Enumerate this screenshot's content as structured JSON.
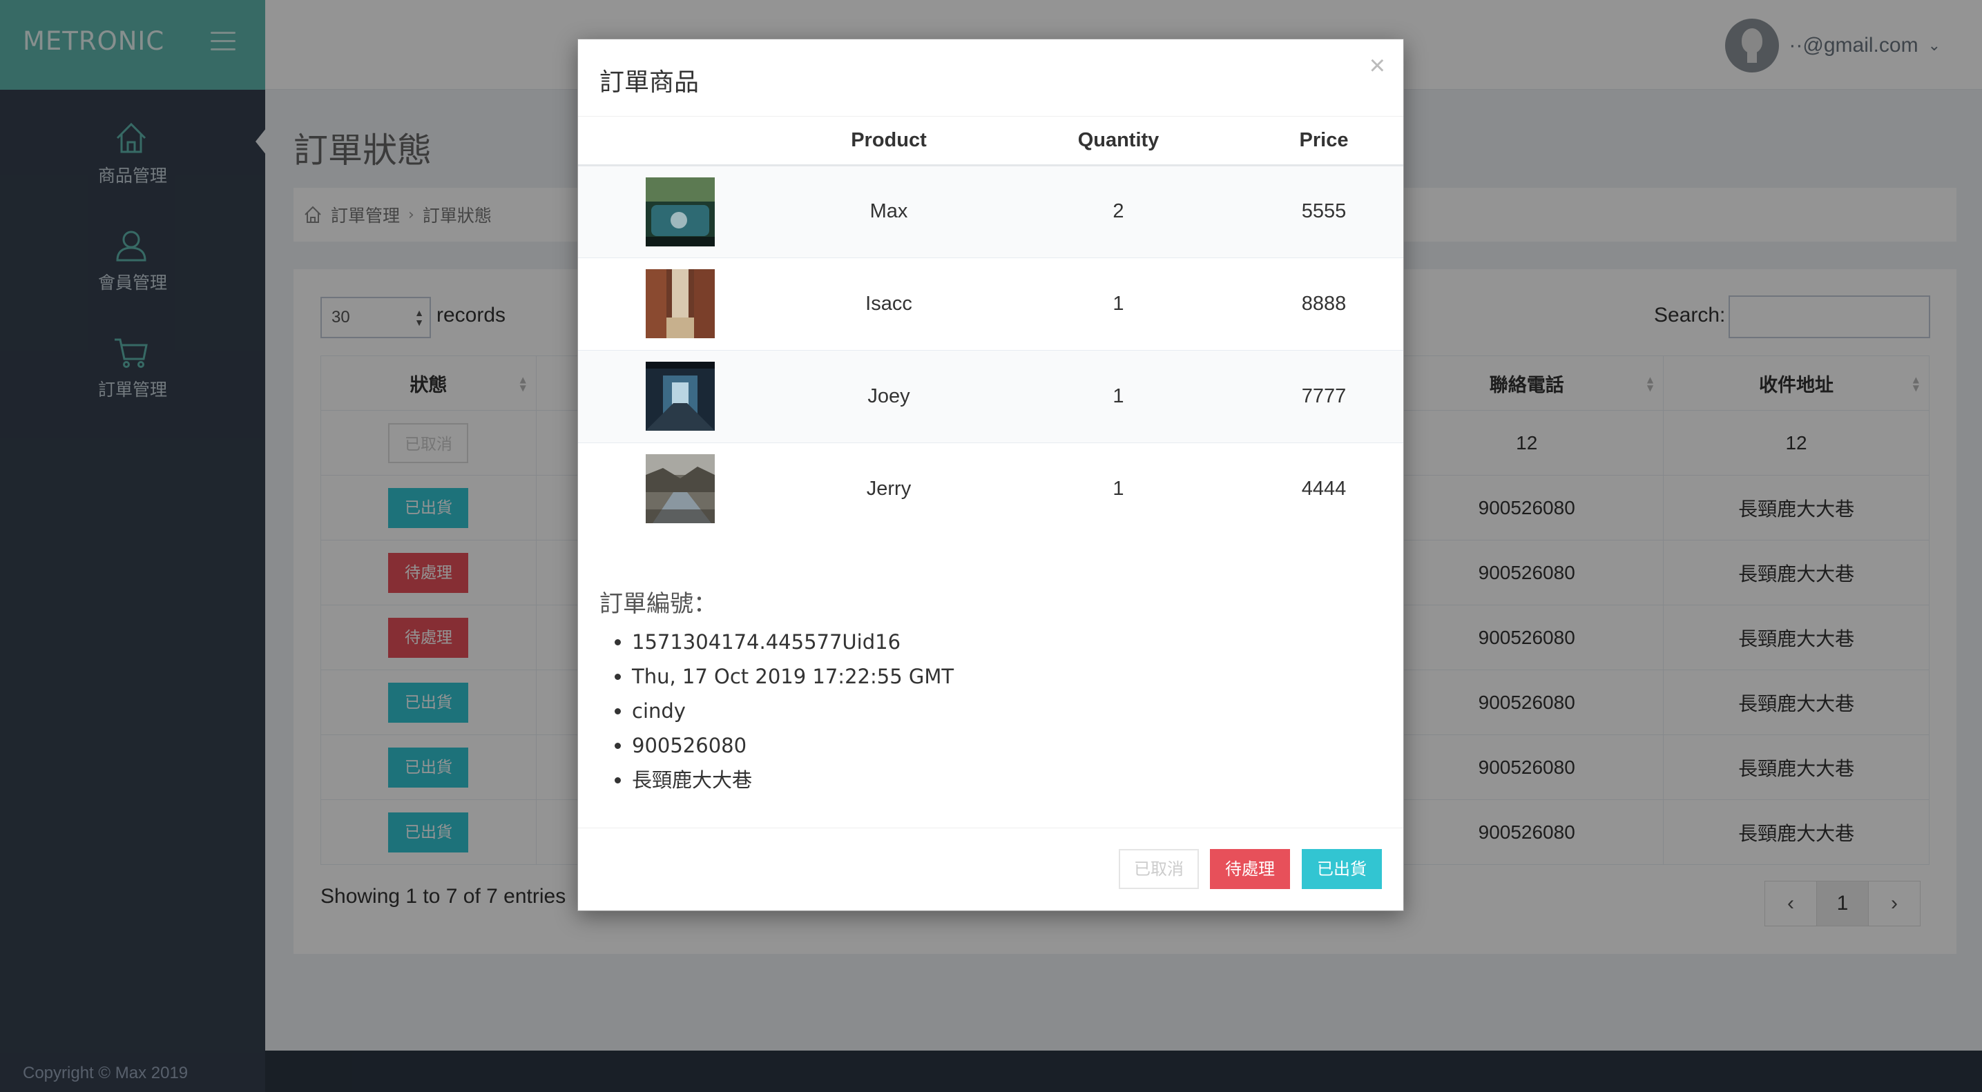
{
  "app": {
    "logo": "METRONIC",
    "user_email": "··@gmail.com",
    "copyright": "Copyright © Max 2019"
  },
  "sidebar": {
    "items": [
      {
        "label": "商品管理",
        "icon": "home-icon"
      },
      {
        "label": "會員管理",
        "icon": "user-icon"
      },
      {
        "label": "訂單管理",
        "icon": "cart-icon"
      }
    ]
  },
  "page": {
    "title": "訂單狀態",
    "breadcrumb": [
      "訂單管理",
      "訂單狀態"
    ],
    "length_value": "30",
    "records_label": "records",
    "search_label": "Search:",
    "search_value": "",
    "table": {
      "headers": [
        "狀態",
        "聯絡電話",
        "收件地址"
      ],
      "rows": [
        {
          "status": "已取消",
          "phone": "12",
          "address": "12"
        },
        {
          "status": "已出貨",
          "phone": "900526080",
          "address": "長頸鹿大大巷"
        },
        {
          "status": "待處理",
          "phone": "900526080",
          "address": "長頸鹿大大巷"
        },
        {
          "status": "待處理",
          "phone": "900526080",
          "address": "長頸鹿大大巷"
        },
        {
          "status": "已出貨",
          "phone": "900526080",
          "address": "長頸鹿大大巷"
        },
        {
          "status": "已出貨",
          "phone": "900526080",
          "address": "長頸鹿大大巷"
        },
        {
          "status": "已出貨",
          "phone": "900526080",
          "address": "長頸鹿大大巷"
        }
      ]
    },
    "showing": "Showing 1 to 7 of 7 entries",
    "pager": {
      "prev": "‹",
      "page": "1",
      "next": "›"
    }
  },
  "modal": {
    "title": "訂單商品",
    "close": "×",
    "columns": [
      "",
      "Product",
      "Quantity",
      "Price"
    ],
    "products": [
      {
        "name": "Max",
        "qty": "2",
        "price": "5555",
        "thumb": "car-photo"
      },
      {
        "name": "Isacc",
        "qty": "1",
        "price": "8888",
        "thumb": "alley-photo"
      },
      {
        "name": "Joey",
        "qty": "1",
        "price": "7777",
        "thumb": "corridor-photo"
      },
      {
        "name": "Jerry",
        "qty": "1",
        "price": "4444",
        "thumb": "river-photo"
      }
    ],
    "order_label": "訂單編號：",
    "order_details": [
      "1571304174.445577Uid16",
      "Thu, 17 Oct 2019 17:22:55 GMT",
      "cindy",
      "900526080",
      "長頸鹿大大巷"
    ],
    "buttons": {
      "cancel": "已取消",
      "pending": "待處理",
      "shipped": "已出貨"
    }
  },
  "colors": {
    "brand": "#5fb7ae",
    "sidebar": "#364150",
    "pending": "#e7505a",
    "shipped": "#32c5d2"
  }
}
